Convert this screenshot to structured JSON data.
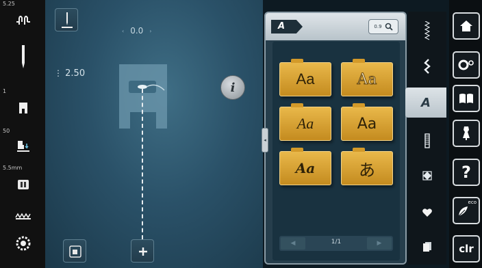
{
  "left_toolbar": {
    "upper_thread_tension": "5.25",
    "needle_position": "1",
    "presser_foot": "50",
    "stitch_width": "5.5mm"
  },
  "canvas": {
    "width_value": "0.0",
    "length_value": "2.50",
    "info_label": "i"
  },
  "font_panel": {
    "active_label": "A",
    "zoom_label": "0.9",
    "fonts": [
      "Aa",
      "Aa",
      "Aa",
      "Aa",
      "Aa",
      "あ"
    ],
    "page_indicator": "1/1"
  },
  "category_bar": {
    "active_label": "A"
  },
  "right_bar": {
    "clr_label": "clr",
    "eco_label": "eco",
    "help_label": "?"
  },
  "colors": {
    "tile_gold": "#e0ab3a",
    "canvas_blue": "#2a5168",
    "panel_bg": "#263e4c"
  }
}
